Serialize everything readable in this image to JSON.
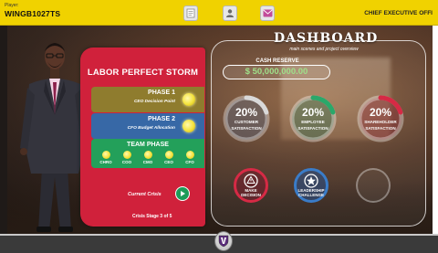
{
  "player": {
    "label": "Player:",
    "id": "WINGB1027TS"
  },
  "role": "CHIEF EXECUTIVE OFFI",
  "top_icons": [
    "notes-icon",
    "profile-icon",
    "mail-icon"
  ],
  "crisis": {
    "title": "LABOR PERFECT STORM",
    "phases": [
      {
        "title": "PHASE 1",
        "subtitle": "CEO Decision Point"
      },
      {
        "title": "PHASE 2",
        "subtitle": "CFO Budget Allocation"
      }
    ],
    "team": {
      "title": "TEAM PHASE",
      "members": [
        "CHRO",
        "COO",
        "CMO",
        "CEO",
        "CFO"
      ]
    },
    "current_label": "Current Crisis",
    "stage": "Crisis Stage 3 of 5"
  },
  "dashboard": {
    "title": "DASHBOARD",
    "subtitle": "main scenes and project overview",
    "cash_label": "CASH RESERVE",
    "cash_value": "$ 50,000,000.00",
    "gauges": [
      {
        "value": "20%",
        "label_line1": "CUSTOMER",
        "label_line2": "SATISFACTION",
        "fraction": 0.2,
        "color": "#d9d9d9"
      },
      {
        "value": "20%",
        "label_line1": "EMPLOYEE",
        "label_line2": "SATISFACTION",
        "fraction": 0.2,
        "color": "#2aa86a"
      },
      {
        "value": "20%",
        "label_line1": "SHAREHOLDER",
        "label_line2": "SATISFACTION",
        "fraction": 0.2,
        "color": "#d62a45"
      }
    ],
    "actions": [
      {
        "line1": "MAKE",
        "line2": "DECISION",
        "icon": "warning-icon",
        "color": "#d62a45"
      },
      {
        "line1": "LEADERSHIP",
        "line2": "CHALLENGE",
        "icon": "star-icon",
        "color": "#3a7cc8"
      }
    ]
  },
  "colors": {
    "topbar": "#f0d200",
    "panel_red": "#d0213b",
    "cash_text": "#9fe08a"
  }
}
